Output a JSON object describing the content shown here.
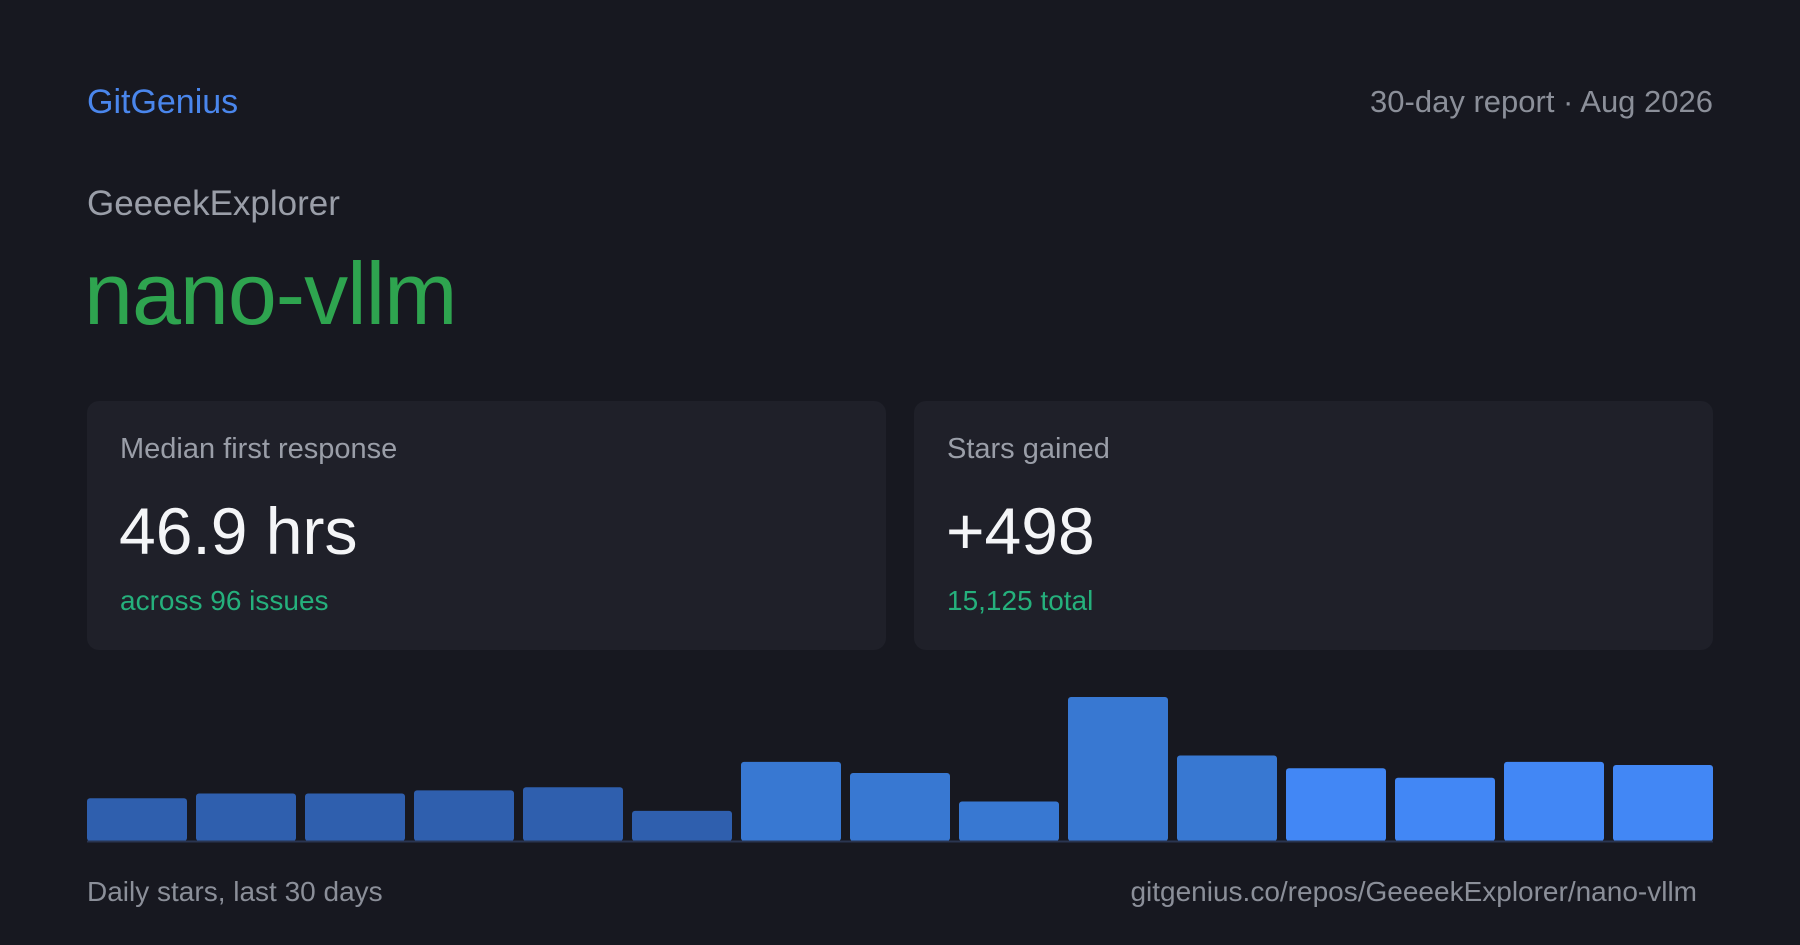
{
  "header": {
    "brand": "GitGenius",
    "period": "30-day report · Aug 2026"
  },
  "repo": {
    "owner": "GeeeekExplorer",
    "name": "nano-vllm"
  },
  "cards": [
    {
      "label": "Median first response",
      "value": "46.9 hrs",
      "sub": "across 96 issues"
    },
    {
      "label": "Stars gained",
      "value": "+498",
      "sub": "15,125  total"
    }
  ],
  "colors": {
    "brand": "#4a86ec",
    "repo_name": "#2ea44f",
    "positive": "#25b07c",
    "bar_early": "#2f5fae",
    "bar_mid": "#3878d2",
    "bar_recent": "#4287f5"
  },
  "chart_data": {
    "type": "bar",
    "title": "",
    "xlabel": "",
    "ylabel": "",
    "values": [
      27,
      30,
      30,
      32,
      34,
      19,
      50,
      43,
      25,
      91,
      54,
      46,
      40,
      50,
      48
    ],
    "tiers": [
      "early",
      "early",
      "early",
      "early",
      "early",
      "early",
      "mid",
      "mid",
      "mid",
      "mid",
      "mid",
      "recent",
      "recent",
      "recent",
      "recent"
    ],
    "ylim": [
      0,
      91
    ],
    "grid": false,
    "legend": "none"
  },
  "footer": {
    "caption": "Daily stars, last 30 days",
    "url": "gitgenius.co/repos/GeeeekExplorer/nano-vllm"
  }
}
